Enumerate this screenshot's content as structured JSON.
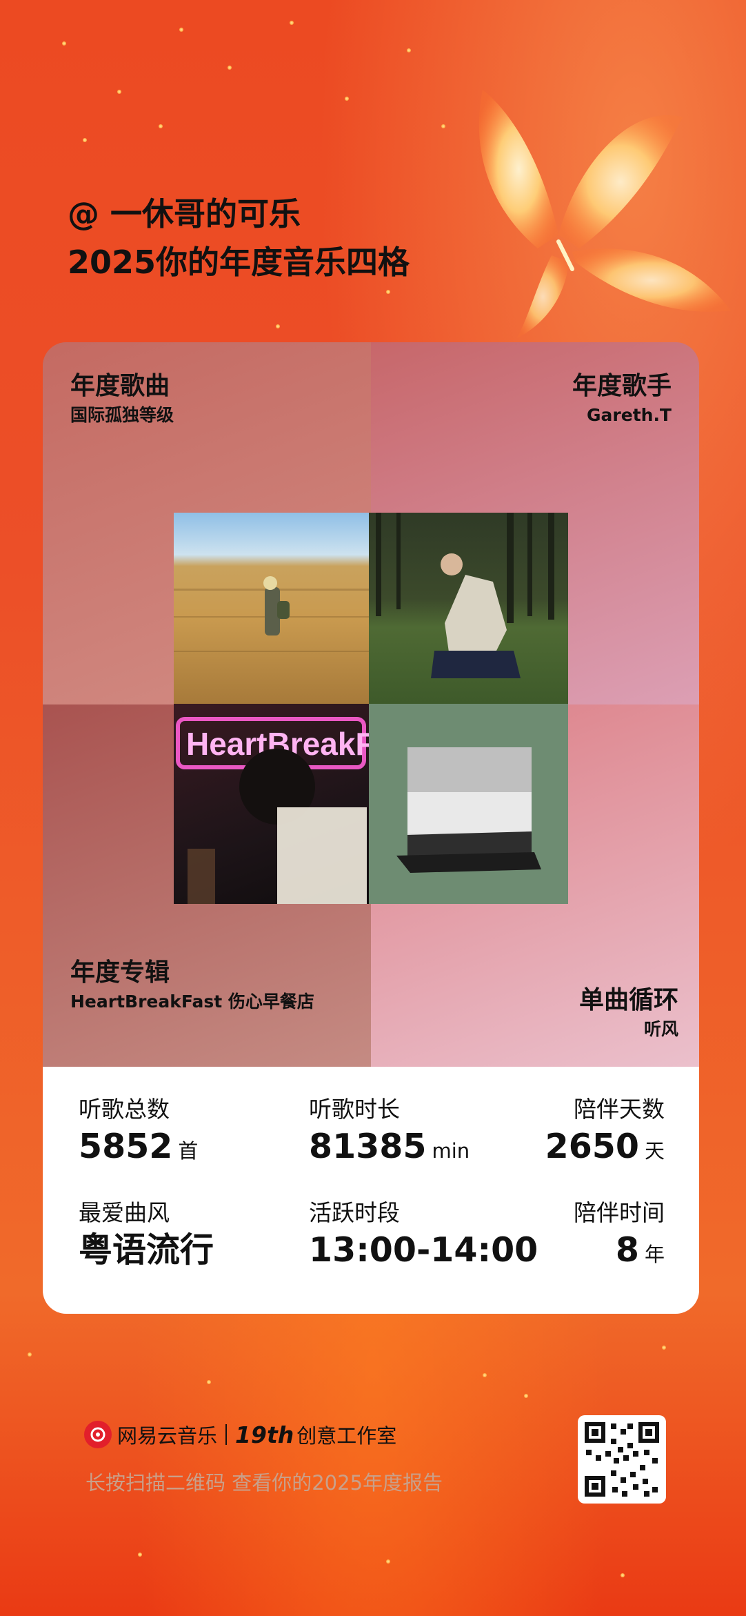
{
  "header": {
    "user_line": "@ 一休哥的可乐",
    "title_line": "2025你的年度音乐四格"
  },
  "grid": {
    "song": {
      "title": "年度歌曲",
      "value": "国际孤独等级"
    },
    "artist": {
      "title": "年度歌手",
      "value": "Gareth.T"
    },
    "album": {
      "title": "年度专辑",
      "value": "HeartBreakFast 伤心早餐店"
    },
    "repeat": {
      "title": "单曲循环",
      "value": "听风"
    },
    "album_cover_text": "HeartBreakFast"
  },
  "stats": {
    "total_songs": {
      "label": "听歌总数",
      "value": "5852",
      "unit": "首"
    },
    "duration": {
      "label": "听歌时长",
      "value": "81385",
      "unit": "min"
    },
    "days": {
      "label": "陪伴天数",
      "value": "2650",
      "unit": "天"
    },
    "genre": {
      "label": "最爱曲风",
      "value": "粤语流行"
    },
    "active": {
      "label": "活跃时段",
      "value": "13:00-14:00"
    },
    "years": {
      "label": "陪伴时间",
      "value": "8",
      "unit": "年"
    }
  },
  "footer": {
    "brand": "网易云音乐",
    "studio_num": "19th",
    "studio_text": "创意工作室",
    "tip": "长按扫描二维码 查看你的2025年度报告"
  },
  "icons": {
    "logo": "netease-music-logo-icon",
    "qr": "qr-code-icon"
  },
  "colors": {
    "background": "#ec4a22",
    "brand_red": "#e21f2b"
  }
}
